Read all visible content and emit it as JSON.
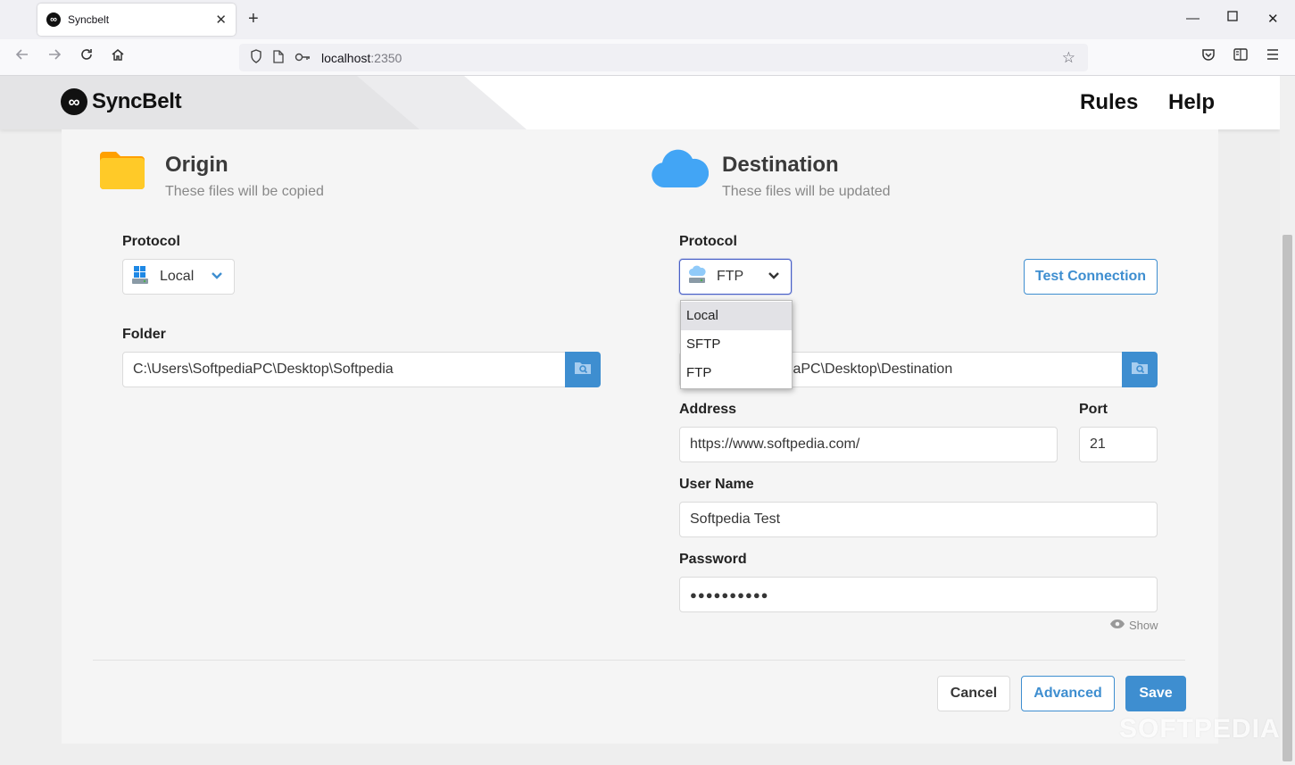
{
  "browser": {
    "tab_title": "Syncbelt",
    "url_host": "localhost",
    "url_port": ":2350",
    "new_tab": "+",
    "tab_close": "✕"
  },
  "app": {
    "brand": "SyncBelt",
    "nav": [
      "Rules",
      "Help"
    ]
  },
  "origin": {
    "title": "Origin",
    "subtitle": "These files will be copied",
    "protocol_label": "Protocol",
    "protocol_value": "Local",
    "folder_label": "Folder",
    "folder_value": "C:\\Users\\SoftpediaPC\\Desktop\\Softpedia"
  },
  "destination": {
    "title": "Destination",
    "subtitle": "These files will be updated",
    "protocol_label": "Protocol",
    "protocol_value": "FTP",
    "test_connection_label": "Test Connection",
    "folder_value_visible": "diaPC\\Desktop\\Destination",
    "address_label": "Address",
    "address_value": "https://www.softpedia.com/",
    "port_label": "Port",
    "port_value": "21",
    "username_label": "User Name",
    "username_value": "Softpedia Test",
    "password_label": "Password",
    "password_value": "●●●●●●●●●●",
    "show_label": "Show"
  },
  "protocol_dropdown": {
    "options": [
      "Local",
      "SFTP",
      "FTP"
    ],
    "highlighted": "Local"
  },
  "footer": {
    "cancel_label": "Cancel",
    "advanced_label": "Advanced",
    "save_label": "Save"
  },
  "watermark": "SOFTPEDIA",
  "colors": {
    "primary": "#3e8ed0",
    "folder_yellow": "#ffc107",
    "cloud_blue": "#42a5f5"
  }
}
